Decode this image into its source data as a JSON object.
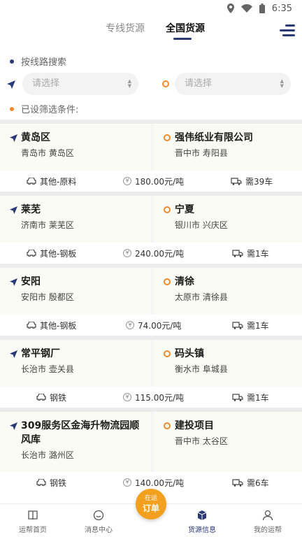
{
  "status_bar": {
    "time": "6:35"
  },
  "header": {
    "tabs": [
      {
        "label": "专线货源",
        "active": false
      },
      {
        "label": "全国货源",
        "active": true
      }
    ]
  },
  "search": {
    "route_label": "按线路搜索",
    "origin_placeholder": "请选择",
    "dest_placeholder": "请选择",
    "filter_label": "已设筛选条件:"
  },
  "cards": [
    {
      "origin_name": "黄岛区",
      "origin_sub": "青岛市 黄岛区",
      "dest_name": "强伟纸业有限公司",
      "dest_sub": "晋中市 寿阳县",
      "cargo": "其他-原料",
      "price": "180.00元/吨",
      "vehicles": "需39车"
    },
    {
      "origin_name": "莱芜",
      "origin_sub": "济南市 莱芜区",
      "dest_name": "宁夏",
      "dest_sub": "银川市 兴庆区",
      "cargo": "其他-钢板",
      "price": "240.00元/吨",
      "vehicles": "需1车"
    },
    {
      "origin_name": "安阳",
      "origin_sub": "安阳市 殷都区",
      "dest_name": "清徐",
      "dest_sub": "太原市 清徐县",
      "cargo": "其他-钢板",
      "price": "74.00元/吨",
      "vehicles": "需1车"
    },
    {
      "origin_name": "常平钢厂",
      "origin_sub": "长治市 壶关县",
      "dest_name": "码头镇",
      "dest_sub": "衡水市 阜城县",
      "cargo": "钢铁",
      "price": "115.00元/吨",
      "vehicles": "需1车"
    },
    {
      "origin_name": "309服务区金海升物流园顺风库",
      "origin_sub": "长治市 潞州区",
      "dest_name": "建投项目",
      "dest_sub": "晋中市 太谷区",
      "cargo": "钢铁",
      "price": "140.00元/吨",
      "vehicles": "需6车"
    }
  ],
  "bottom_nav": {
    "items": [
      {
        "label": "运帮首页",
        "icon": "book-icon"
      },
      {
        "label": "消息中心",
        "icon": "message-icon"
      },
      {
        "label": "货源信息",
        "icon": "box-icon",
        "active": true
      },
      {
        "label": "我的运帮",
        "icon": "user-icon"
      }
    ],
    "center": {
      "top": "在运",
      "bottom": "订单"
    }
  },
  "colors": {
    "navy": "#2b3a77",
    "orange": "#f08a2c",
    "center_button": "#f3a01e"
  }
}
